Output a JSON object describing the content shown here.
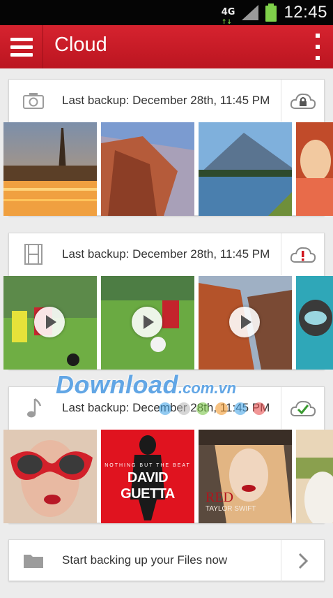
{
  "status_bar": {
    "network": "4G",
    "network_sub": "↑↓",
    "time": "12:45"
  },
  "app_bar": {
    "title": "Cloud"
  },
  "sections": [
    {
      "type": "photos",
      "label": "Last backup: December 28th, 11:45 PM",
      "status_icon": "cloud-lock-icon"
    },
    {
      "type": "videos",
      "label": "Last backup: December 28th, 11:45 PM",
      "status_icon": "cloud-warning-icon"
    },
    {
      "type": "music",
      "label": "Last backup: December 28th, 11:45 PM",
      "status_icon": "cloud-check-icon",
      "albums": [
        {
          "artist_top": "NOTHING BUT THE BEAT",
          "artist": "DAVID GUETTA"
        },
        {
          "title": "RED",
          "artist": "TAYLOR SWIFT"
        }
      ]
    }
  ],
  "files": {
    "label": "Start backing up your Files now"
  },
  "watermark": {
    "main": "Download",
    "sub": ".com.vn"
  },
  "colors": {
    "accent": "#c81b26",
    "warning": "#d0141c",
    "check": "#3a9a30"
  }
}
